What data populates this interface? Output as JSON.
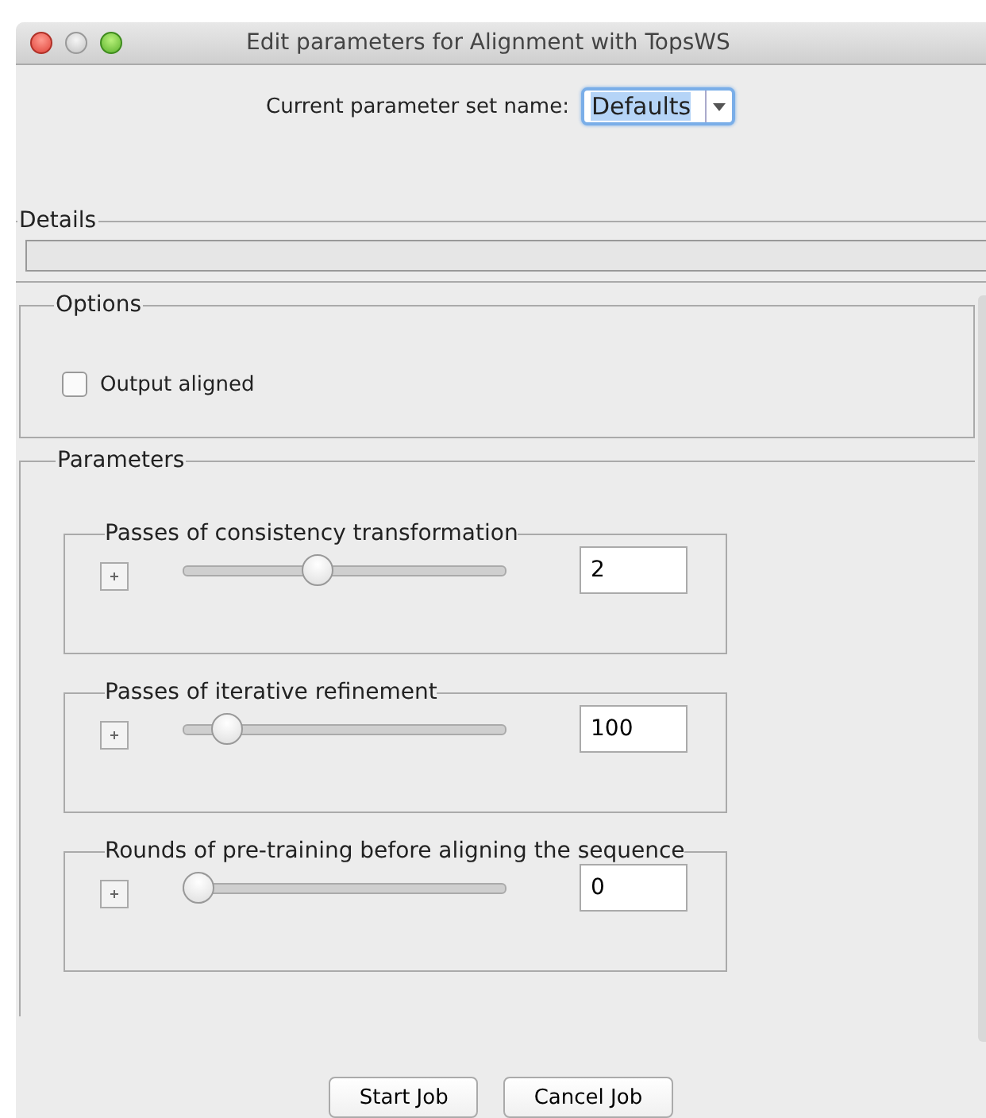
{
  "window": {
    "title": "Edit parameters for Alignment with TopsWS"
  },
  "parameter_set": {
    "label": "Current parameter set name:",
    "value": "Defaults"
  },
  "details": {
    "title": "Details"
  },
  "options": {
    "title": "Options",
    "items": [
      {
        "label": "Output aligned",
        "checked": false
      }
    ]
  },
  "parameters": {
    "title": "Parameters",
    "groups": [
      {
        "title": "Passes of consistency transformation",
        "level": 0.41,
        "value": "2"
      },
      {
        "title": "Passes of iterative refinement",
        "level": 0.1,
        "value": "100"
      },
      {
        "title": "Rounds of pre-training before aligning the sequence",
        "level": 0,
        "value": "0"
      }
    ]
  },
  "buttons": [
    "Start Job",
    "Cancel Job"
  ]
}
